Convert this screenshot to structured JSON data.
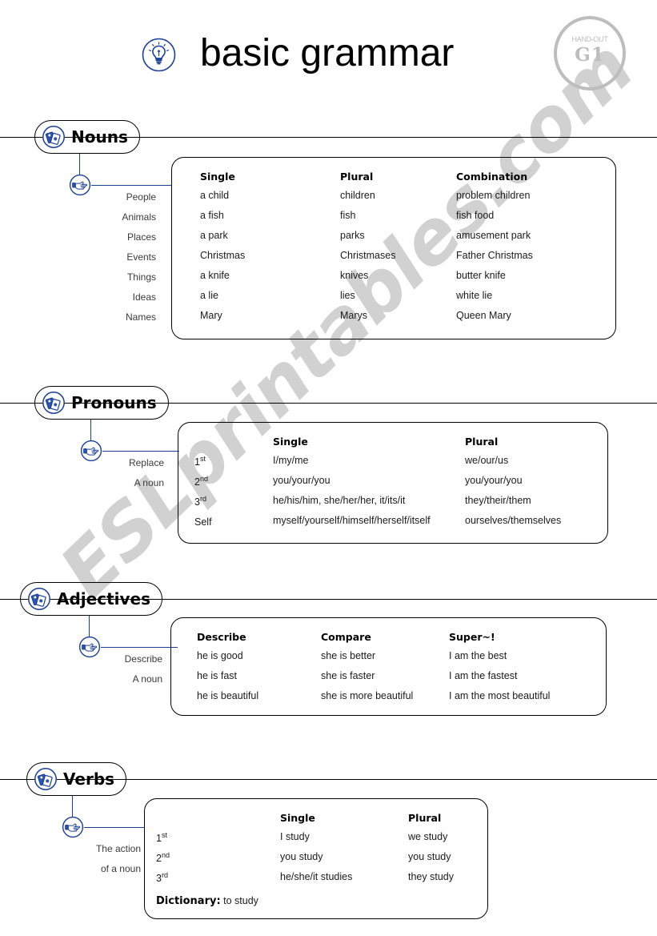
{
  "header": {
    "title": "basic grammar",
    "bulb_icon": "lightbulb-icon",
    "badge": {
      "kicker": "HAND-OUT",
      "code": "G1"
    }
  },
  "watermark": {
    "text": "ESLprintables.com",
    "color": "#c9c9c9"
  },
  "colors": {
    "icon_blue": "#1c3f94",
    "badge_gray": "#bdbdbd",
    "line_black": "#000000"
  },
  "sections": [
    {
      "id": "nouns",
      "title": "Nouns",
      "side_labels": [
        "People",
        "Animals",
        "Places",
        "Events",
        "Things",
        "Ideas",
        "Names"
      ],
      "table": {
        "headers": [
          "Single",
          "Plural",
          "Combination"
        ],
        "rows": [
          [
            "a child",
            "children",
            "problem children"
          ],
          [
            "a fish",
            "fish",
            "fish food"
          ],
          [
            "a park",
            "parks",
            "amusement park"
          ],
          [
            "Christmas",
            "Christmases",
            "Father Christmas"
          ],
          [
            "a knife",
            "knives",
            "butter knife"
          ],
          [
            "a lie",
            "lies",
            "white lie"
          ],
          [
            "Mary",
            "Marys",
            "Queen Mary"
          ]
        ]
      }
    },
    {
      "id": "pronouns",
      "title": "Pronouns",
      "side_labels": [
        "Replace",
        "A noun"
      ],
      "table": {
        "headers": [
          "",
          "Single",
          "Plural"
        ],
        "row_heads": [
          {
            "num": "1",
            "sup": "st"
          },
          {
            "num": "2",
            "sup": "nd"
          },
          {
            "num": "3",
            "sup": "rd"
          },
          {
            "num": "Self",
            "sup": ""
          }
        ],
        "rows": [
          [
            "I/my/me",
            "we/our/us"
          ],
          [
            "you/your/you",
            "you/your/you"
          ],
          [
            "he/his/him, she/her/her, it/its/it",
            "they/their/them"
          ],
          [
            "myself/yourself/himself/herself/itself",
            "ourselves/themselves"
          ]
        ]
      }
    },
    {
      "id": "adjectives",
      "title": "Adjectives",
      "side_labels": [
        "Describe",
        "A noun"
      ],
      "table": {
        "headers": [
          "Describe",
          "Compare",
          "Super~!"
        ],
        "rows": [
          [
            "he is good",
            "she is better",
            "I am the best"
          ],
          [
            "he is fast",
            "she is faster",
            "I am the fastest"
          ],
          [
            "he is beautiful",
            "she is more beautiful",
            "I am the most beautiful"
          ]
        ]
      }
    },
    {
      "id": "verbs",
      "title": "Verbs",
      "side_labels": [
        "The action",
        "of a noun"
      ],
      "table": {
        "headers": [
          "",
          "Single",
          "Plural"
        ],
        "row_heads": [
          {
            "num": "1",
            "sup": "st"
          },
          {
            "num": "2",
            "sup": "nd"
          },
          {
            "num": "3",
            "sup": "rd"
          }
        ],
        "rows": [
          [
            "I study",
            "we study"
          ],
          [
            "you study",
            "you study"
          ],
          [
            "he/she/it studies",
            "they study"
          ]
        ],
        "dictionary_label": "Dictionary:",
        "dictionary_value": "to study"
      }
    }
  ]
}
